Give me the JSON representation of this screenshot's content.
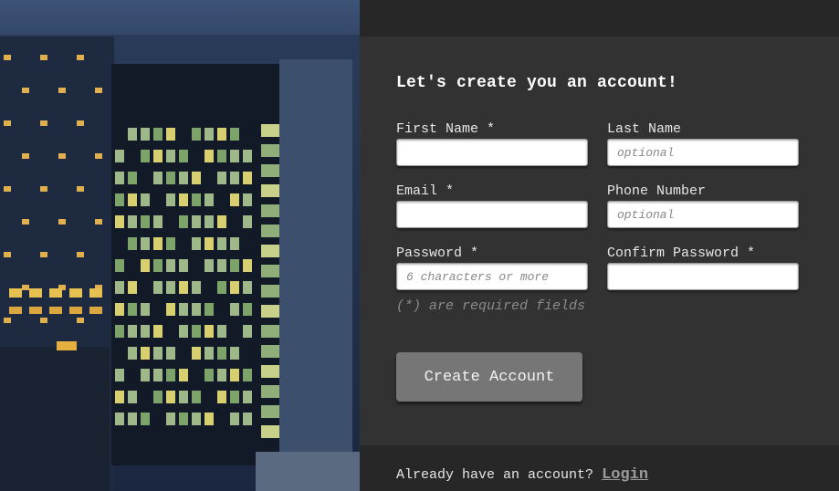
{
  "form": {
    "title": "Let's create you an account!",
    "first_name": {
      "label": "First Name *",
      "value": "",
      "placeholder": ""
    },
    "last_name": {
      "label": "Last Name",
      "value": "",
      "placeholder": "optional"
    },
    "email": {
      "label": "Email *",
      "value": "",
      "placeholder": ""
    },
    "phone": {
      "label": "Phone Number",
      "value": "",
      "placeholder": "optional"
    },
    "password": {
      "label": "Password *",
      "value": "",
      "placeholder": "6 characters or more"
    },
    "confirm_password": {
      "label": "Confirm Password *",
      "value": "",
      "placeholder": ""
    },
    "required_note": "(*) are required fields",
    "submit_label": "Create Account"
  },
  "footer": {
    "prompt": "Already have an account?",
    "login_label": "Login"
  },
  "colors": {
    "panel_bg": "#323232",
    "bar_bg": "#272727",
    "button_bg": "#767676",
    "photo_tone": "#24344f"
  }
}
